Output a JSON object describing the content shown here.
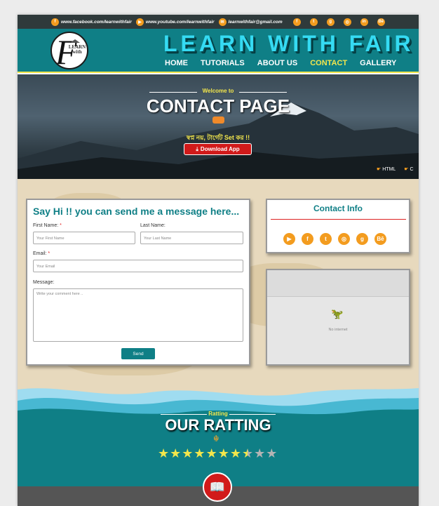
{
  "topbar": {
    "links": [
      {
        "icon": "facebook-icon",
        "glyph": "f",
        "text": "www.facebook.com/learnwithfair"
      },
      {
        "icon": "youtube-icon",
        "glyph": "▶",
        "text": "www.youtube.com/learnwithfair"
      },
      {
        "icon": "mail-icon",
        "glyph": "✉",
        "text": "learnwithfair@gmail.com"
      }
    ],
    "icons": [
      {
        "name": "facebook-icon",
        "glyph": "f"
      },
      {
        "name": "twitter-icon",
        "glyph": "t"
      },
      {
        "name": "github-icon",
        "glyph": "g"
      },
      {
        "name": "instagram-icon",
        "glyph": "◎"
      },
      {
        "name": "linkedin-icon",
        "glyph": "in"
      },
      {
        "name": "behance-icon",
        "glyph": "Bē"
      }
    ]
  },
  "header": {
    "brand": "LEARN WITH FAIR",
    "logo_letter": "F",
    "logo_text": "LEARN with",
    "nav": [
      "HOME",
      "TUTORIALS",
      "ABOUT US",
      "CONTACT",
      "GALLERY"
    ],
    "active_nav": "CONTACT"
  },
  "hero": {
    "welcome": "Welcome to",
    "title": "CONTACT PAGE",
    "tagline": "স্বপ্ন নয়, টার্গেট Set কর !!",
    "download_label": "Download App",
    "tags": [
      "HTML",
      "C"
    ]
  },
  "form": {
    "title": "Say Hi !! you can send me a message here...",
    "first_name_label": "First Name:",
    "first_name_placeholder": "Your First Name",
    "last_name_label": "Last Name:",
    "last_name_placeholder": "Your Last Name",
    "email_label": "Email:",
    "email_placeholder": "Your Email",
    "message_label": "Message:",
    "message_placeholder": "Write your comment here ..",
    "required_mark": "*",
    "send_label": "Send"
  },
  "contact_info": {
    "title": "Contact Info",
    "icons": [
      {
        "name": "youtube-icon",
        "glyph": "▶"
      },
      {
        "name": "facebook-icon",
        "glyph": "f"
      },
      {
        "name": "twitter-icon",
        "glyph": "t"
      },
      {
        "name": "instagram-icon",
        "glyph": "◎"
      },
      {
        "name": "github-icon",
        "glyph": "g"
      },
      {
        "name": "behance-icon",
        "glyph": "Bē"
      }
    ]
  },
  "map": {
    "status": "No internet"
  },
  "rating": {
    "small": "Ratting",
    "title": "OUR RATTING",
    "stars_total": 10,
    "stars_value": 7.5
  },
  "colors": {
    "teal": "#0f7f86",
    "yellow": "#f2e64c",
    "orange": "#f39c1f",
    "red": "#d11a1a"
  }
}
